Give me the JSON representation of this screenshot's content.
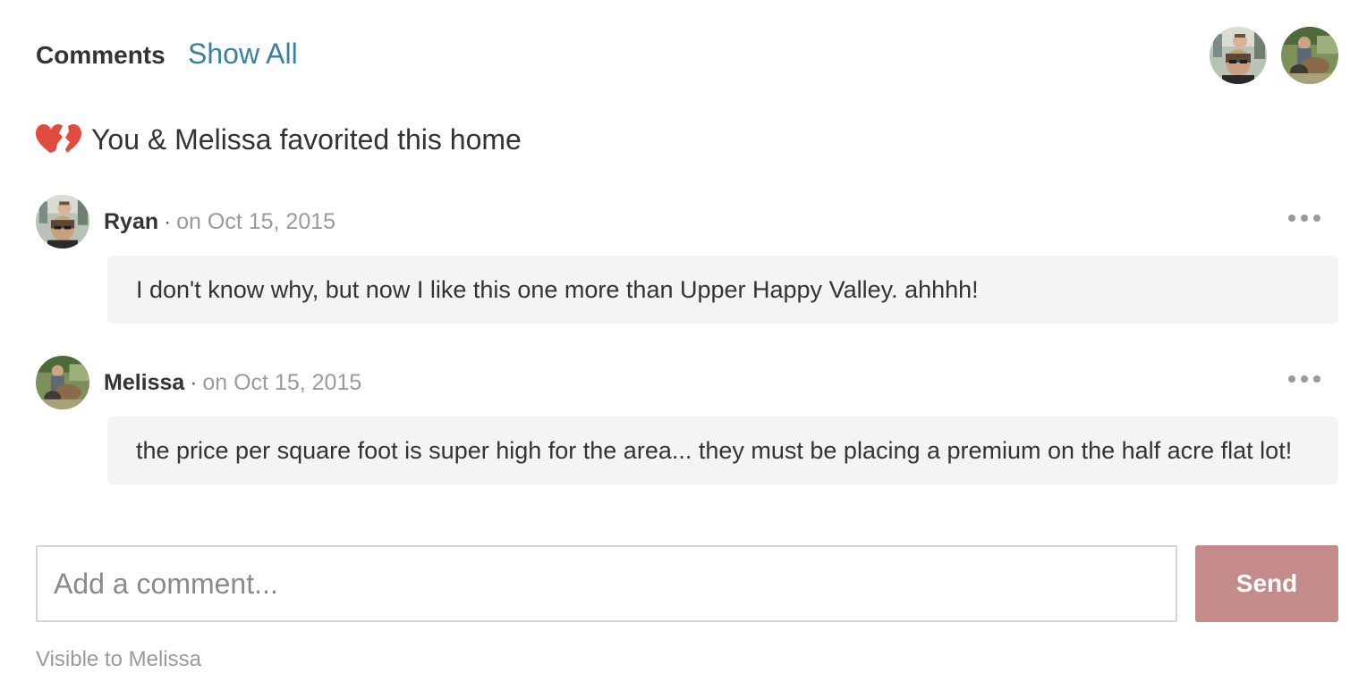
{
  "header": {
    "title": "Comments",
    "show_all_label": "Show All"
  },
  "favorites": {
    "icon": "broken-hearts-icon",
    "text": "You & Melissa favorited this home",
    "icon_color": "#e04a3f"
  },
  "comments": [
    {
      "author": "Ryan",
      "separator": "·",
      "date": "on Oct 15, 2015",
      "body": "I don't know why, but now I like this one more than Upper Happy Valley. ahhhh!"
    },
    {
      "author": "Melissa",
      "separator": "·",
      "date": "on Oct 15, 2015",
      "body": "the price per square foot is super high for the area... they must be placing a premium on the half acre flat lot!"
    }
  ],
  "compose": {
    "placeholder": "Add a comment...",
    "value": "",
    "send_label": "Send"
  },
  "visibility_note": "Visible to Melissa",
  "colors": {
    "link": "#3d7fa0",
    "send_button": "#c48b8b",
    "bubble_bg": "#f4f4f4",
    "muted_text": "#9a9a9a"
  }
}
